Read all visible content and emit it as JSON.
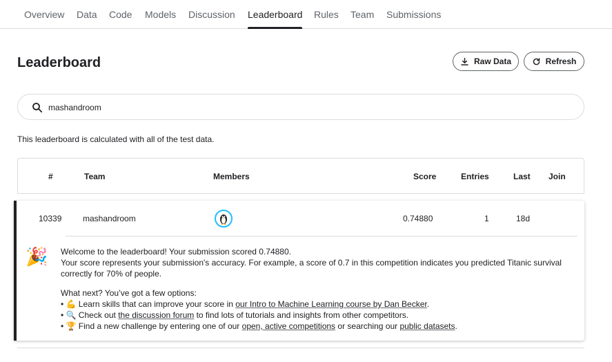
{
  "tabs": [
    {
      "label": "Overview"
    },
    {
      "label": "Data"
    },
    {
      "label": "Code"
    },
    {
      "label": "Models"
    },
    {
      "label": "Discussion"
    },
    {
      "label": "Leaderboard",
      "active": true
    },
    {
      "label": "Rules"
    },
    {
      "label": "Team"
    },
    {
      "label": "Submissions"
    }
  ],
  "page": {
    "title": "Leaderboard",
    "raw_data_label": "Raw Data",
    "refresh_label": "Refresh"
  },
  "search": {
    "value": "mashandroom",
    "icon": "search-icon"
  },
  "note": "This leaderboard is calculated with all of the test data.",
  "table": {
    "headers": {
      "rank": "#",
      "team": "Team",
      "members": "Members",
      "score": "Score",
      "entries": "Entries",
      "last": "Last",
      "join": "Join"
    },
    "row": {
      "rank": "10339",
      "team": "mashandroom",
      "score": "0.74880",
      "entries": "1",
      "last": "18d"
    }
  },
  "message": {
    "icon": "party-popper-icon",
    "line1": "Welcome to the leaderboard! Your submission scored 0.74880.",
    "line2": "Your score represents your submission's accuracy. For example, a score of 0.7 in this competition indicates you predicted Titanic survival",
    "line3": "correctly for 70% of people.",
    "next_title": "What next? You’ve got a few options:",
    "opt1_prefix": "• 💪 Learn skills that can improve your score in ",
    "opt1_link": "our Intro to Machine Learning course by Dan Becker",
    "opt1_suffix": ".",
    "opt2_prefix": "• 🔍 Check out ",
    "opt2_link": "the discussion forum",
    "opt2_suffix": " to find lots of tutorials and insights from other competitors.",
    "opt3_prefix": "• 🏆 Find a new challenge by entering one of our ",
    "opt3_link1": "open, active competitions",
    "opt3_mid": " or searching our ",
    "opt3_link2": "public datasets",
    "opt3_suffix": "."
  },
  "colors": {
    "accent": "#20beff",
    "text": "#202124",
    "muted": "#5f6368",
    "border": "#dadce0"
  }
}
